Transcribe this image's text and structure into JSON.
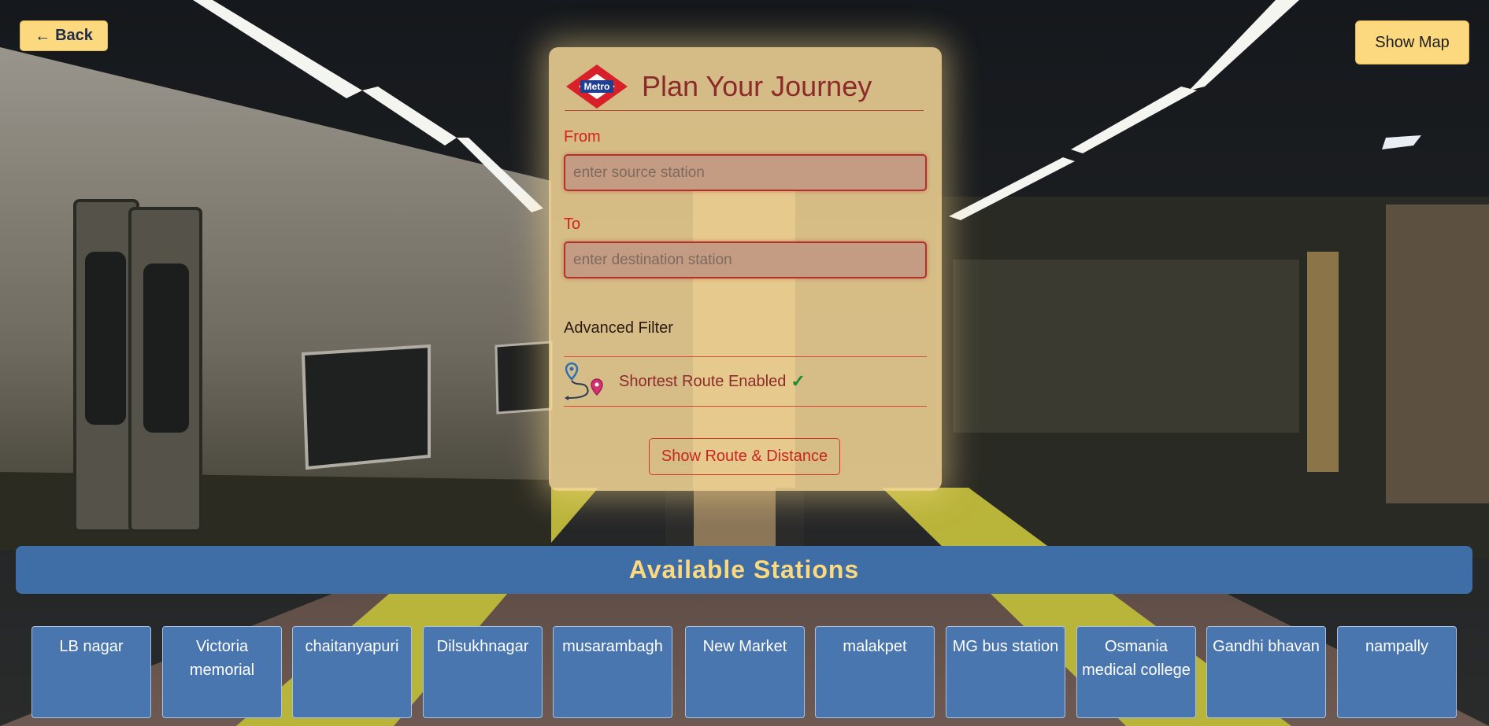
{
  "nav": {
    "back_label": "Back",
    "show_map_label": "Show Map"
  },
  "journey": {
    "title": "Plan Your Journey",
    "logo_text": "Metro",
    "from_label": "From",
    "from_placeholder": "enter source station",
    "to_label": "To",
    "to_placeholder": "enter destination station",
    "advanced_filter_label": "Advanced Filter",
    "shortest_route_label": "Shortest Route Enabled",
    "show_route_button": "Show Route & Distance"
  },
  "stations": {
    "title": "Available Stations",
    "items": [
      "LB nagar",
      "Victoria memorial",
      "chaitanyapuri",
      "Dilsukhnagar",
      "musarambagh",
      "New Market",
      "malakpet",
      "MG bus station",
      "Osmania medical college",
      "Gandhi bhavan",
      "nampally"
    ]
  },
  "colors": {
    "accent_yellow": "#fcd97e",
    "banner_blue": "#3e6ea5",
    "card_blue": "#4a76b0",
    "title_red": "#8c2b2b",
    "label_red": "#d6221c"
  }
}
